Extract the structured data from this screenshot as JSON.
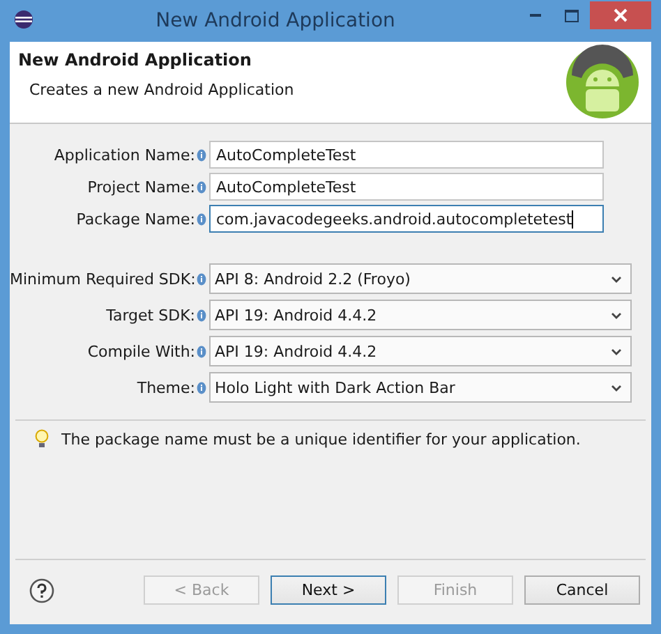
{
  "window": {
    "title": "New Android Application"
  },
  "header": {
    "title": "New Android Application",
    "subtitle": "Creates a new Android Application"
  },
  "fields": [
    {
      "label": "Application Name:",
      "value": "AutoCompleteTest",
      "focused": false
    },
    {
      "label": "Project Name:",
      "value": "AutoCompleteTest",
      "focused": false
    },
    {
      "label": "Package Name:",
      "value": "com.javacodegeeks.android.autocompletetest",
      "focused": true
    }
  ],
  "selects": [
    {
      "label": "Minimum Required SDK:",
      "value": "API 8: Android 2.2 (Froyo)"
    },
    {
      "label": "Target SDK:",
      "value": "API 19: Android 4.4.2"
    },
    {
      "label": "Compile With:",
      "value": "API 19: Android 4.4.2"
    },
    {
      "label": "Theme:",
      "value": "Holo Light with Dark Action Bar"
    }
  ],
  "hint": "The package name must be a unique identifier for your application.",
  "buttons": [
    {
      "label": "< Back",
      "disabled": true,
      "default": false
    },
    {
      "label": "Next >",
      "disabled": false,
      "default": true
    },
    {
      "label": "Finish",
      "disabled": true,
      "default": false
    },
    {
      "label": "Cancel",
      "disabled": false,
      "default": false
    }
  ]
}
